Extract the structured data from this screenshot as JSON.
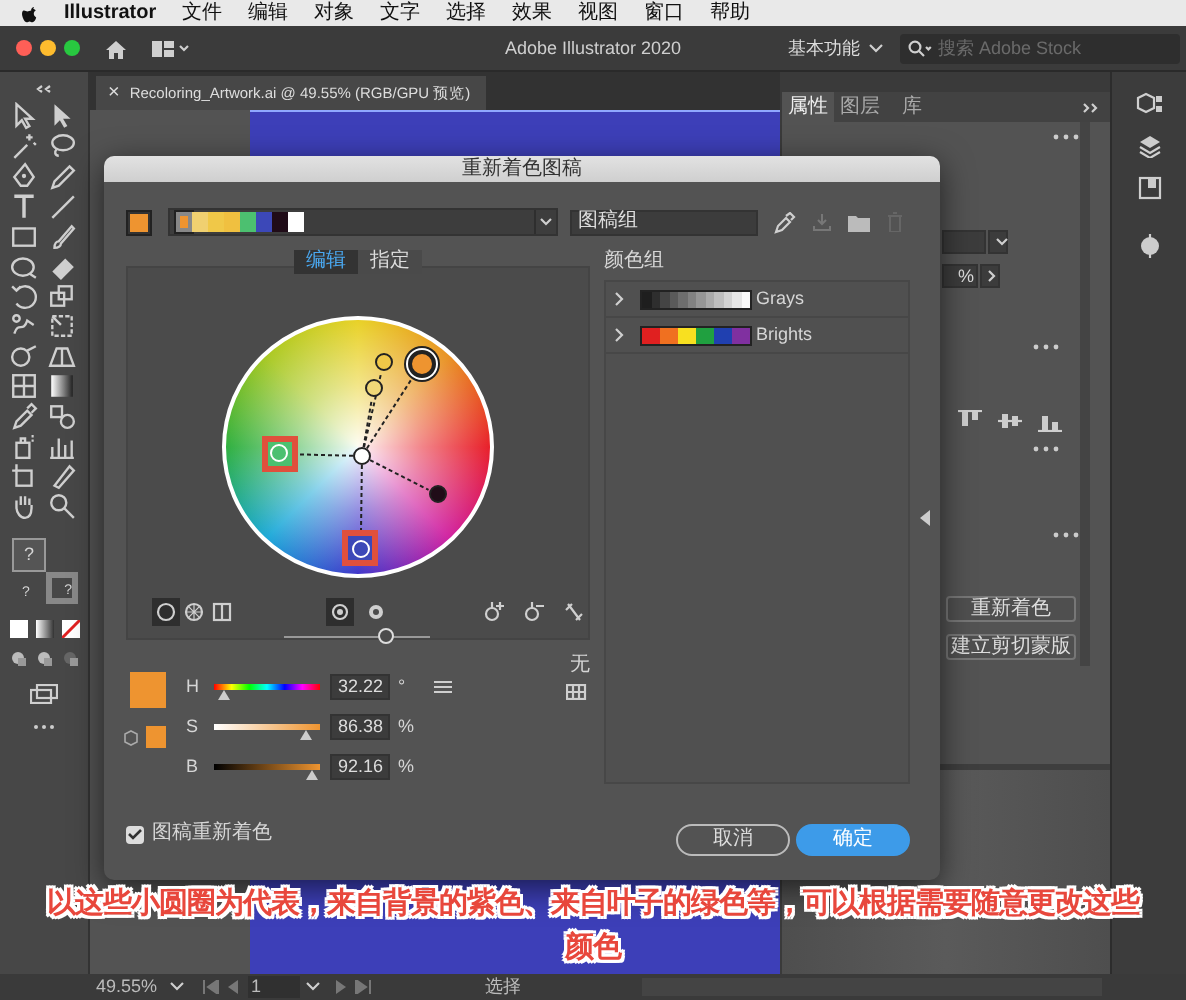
{
  "menu_bar": {
    "app_name": "Illustrator",
    "items": [
      "文件",
      "编辑",
      "对象",
      "文字",
      "选择",
      "效果",
      "视图",
      "窗口",
      "帮助"
    ]
  },
  "window": {
    "title": "Adobe Illustrator 2020",
    "workspace": "基本功能",
    "search_placeholder": "搜索 Adobe Stock"
  },
  "toolbar": {
    "fill_stroke_marks": [
      "?",
      "?",
      "?"
    ]
  },
  "document_tab": {
    "close": "×",
    "title": "Recoloring_Artwork.ai @ 49.55% (RGB/GPU 预览)"
  },
  "panel_tabs": [
    {
      "label": "属性",
      "selected": true
    },
    {
      "label": "图层",
      "selected": false
    },
    {
      "label": "库",
      "selected": false
    }
  ],
  "properties_panel": {
    "field_value": "%",
    "buttons": [
      "重新着色",
      "建立剪切蒙版"
    ]
  },
  "dialog": {
    "title": "重新着色图稿",
    "current_swatch": {
      "color": "#ee9430"
    },
    "harmony_colors": [
      {
        "color": "#ee9430",
        "selected": true
      },
      {
        "color": "#f0d070",
        "selected": false
      },
      {
        "color": "#f0c848",
        "selected": false
      },
      {
        "color": "#f0c040",
        "selected": false
      },
      {
        "color": "#4cc070",
        "selected": false
      },
      {
        "color": "#3c48b8",
        "selected": false
      },
      {
        "color": "#200c18",
        "selected": false
      },
      {
        "color": "#ffffff",
        "selected": false
      }
    ],
    "group_name": "图稿组",
    "tabs": [
      {
        "label": "编辑",
        "selected": true
      },
      {
        "label": "指定",
        "selected": false
      }
    ],
    "wheel_markers": [
      {
        "color": "#ee9430",
        "base": true,
        "highlighted": false
      },
      {
        "color": "#f0c848",
        "base": false,
        "highlighted": false
      },
      {
        "color": "#f0d878",
        "base": false,
        "highlighted": false
      },
      {
        "color": "#4cc070",
        "base": false,
        "highlighted": true
      },
      {
        "color": "#ffffff",
        "base": false,
        "highlighted": false
      },
      {
        "color": "#200c18",
        "base": false,
        "highlighted": false
      },
      {
        "color": "#3c48b8",
        "base": false,
        "highlighted": true
      }
    ],
    "wheel_slider": {
      "level": 0.7
    },
    "hsb": [
      {
        "kind": "hue",
        "label": "H",
        "value": "32.22",
        "unit": "°",
        "level": 0.09
      },
      {
        "kind": "saturation",
        "label": "S",
        "value": "86.38",
        "unit": "%",
        "level": 0.86
      },
      {
        "kind": "brightness",
        "label": "B",
        "value": "92.16",
        "unit": "%",
        "level": 0.92
      }
    ],
    "none_label": "无",
    "color_groups_label": "颜色组",
    "color_groups": [
      {
        "name": "Grays",
        "expanded": false,
        "colors": [
          {
            "color": "#1e1e1e"
          },
          {
            "color": "#2e2e2e"
          },
          {
            "color": "#444444"
          },
          {
            "color": "#5a5a5a"
          },
          {
            "color": "#6e6e6e"
          },
          {
            "color": "#828282"
          },
          {
            "color": "#969696"
          },
          {
            "color": "#aaaaaa"
          },
          {
            "color": "#bebebe"
          },
          {
            "color": "#d2d2d2"
          },
          {
            "color": "#e6e6e6"
          },
          {
            "color": "#fafafa"
          }
        ]
      },
      {
        "name": "Brights",
        "expanded": false,
        "colors": [
          {
            "color": "#e02020"
          },
          {
            "color": "#f07020"
          },
          {
            "color": "#f8e020"
          },
          {
            "color": "#20a040"
          },
          {
            "color": "#2040b0"
          },
          {
            "color": "#8030a0"
          }
        ]
      }
    ],
    "recolor_artwork": {
      "label": "图稿重新着色",
      "checked": true
    },
    "buttons": [
      {
        "label": "取消",
        "kind": "secondary"
      },
      {
        "label": "确定",
        "kind": "primary"
      }
    ]
  },
  "subtitle": {
    "lines": [
      "以这些小圆圈为代表，来自背景的紫色、来自叶子的绿色等，可以根据需要随意更改这些",
      "颜色"
    ]
  },
  "status_bar": {
    "zoom": "49.55%",
    "page": "1",
    "tool": "选择"
  }
}
